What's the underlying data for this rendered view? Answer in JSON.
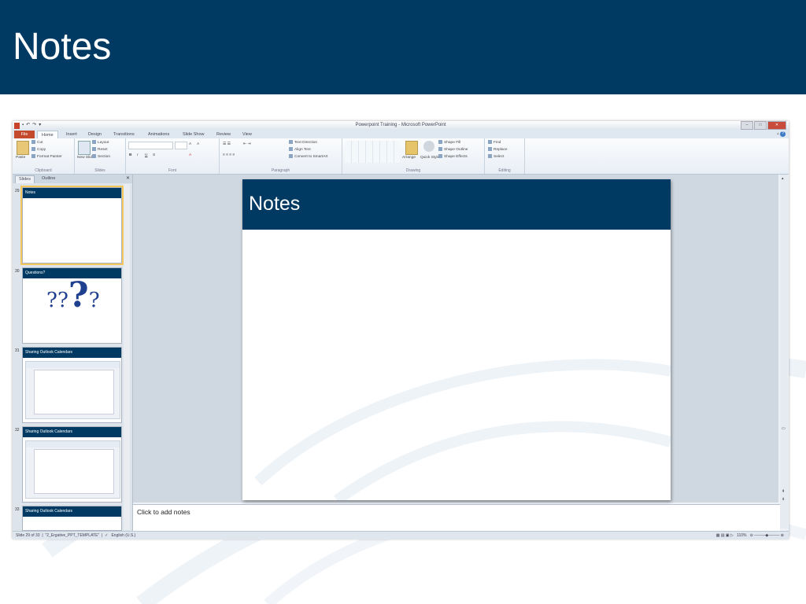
{
  "slide_header": {
    "title": "Notes"
  },
  "app": {
    "window_title": "Powerpoint Training - Microsoft PowerPoint",
    "ribbon_tabs": [
      "File",
      "Home",
      "Insert",
      "Design",
      "Transitions",
      "Animations",
      "Slide Show",
      "Review",
      "View"
    ],
    "active_tab": "Home",
    "ribbon": {
      "clipboard": {
        "label": "Clipboard",
        "paste": "Paste",
        "cut": "Cut",
        "copy": "Copy",
        "format_painter": "Format Painter"
      },
      "slides": {
        "label": "Slides",
        "new_slide": "New Slide",
        "layout": "Layout",
        "reset": "Reset",
        "section": "Section"
      },
      "font": {
        "label": "Font",
        "bold": "B",
        "italic": "I",
        "underline": "U",
        "strikethrough": "S"
      },
      "paragraph": {
        "label": "Paragraph",
        "text_direction": "Text Direction",
        "align_text": "Align Text",
        "convert_smartart": "Convert to SmartArt"
      },
      "drawing": {
        "label": "Drawing",
        "arrange": "Arrange",
        "quick_styles": "Quick Styles",
        "shape_fill": "Shape Fill",
        "shape_outline": "Shape Outline",
        "shape_effects": "Shape Effects"
      },
      "editing": {
        "label": "Editing",
        "find": "Find",
        "replace": "Replace",
        "select": "Select"
      }
    },
    "panel_tabs": {
      "slides": "Slides",
      "outline": "Outline"
    },
    "thumbnails": [
      {
        "number": "29",
        "title": "Notes"
      },
      {
        "number": "30",
        "title": "Questions?"
      },
      {
        "number": "31",
        "title": "Sharing Outlook Calendars"
      },
      {
        "number": "32",
        "title": "Sharing Outlook Calendars"
      },
      {
        "number": "33",
        "title": "Sharing Outlook Calendars"
      }
    ],
    "current_slide": {
      "title": "Notes"
    },
    "notes_placeholder": "Click to add notes",
    "status": {
      "slide_info": "Slide 29 of 33",
      "theme": "\"2_Ergative_PPT_TEMPLATE\"",
      "language": "English (U.S.)",
      "zoom": "110%"
    }
  }
}
